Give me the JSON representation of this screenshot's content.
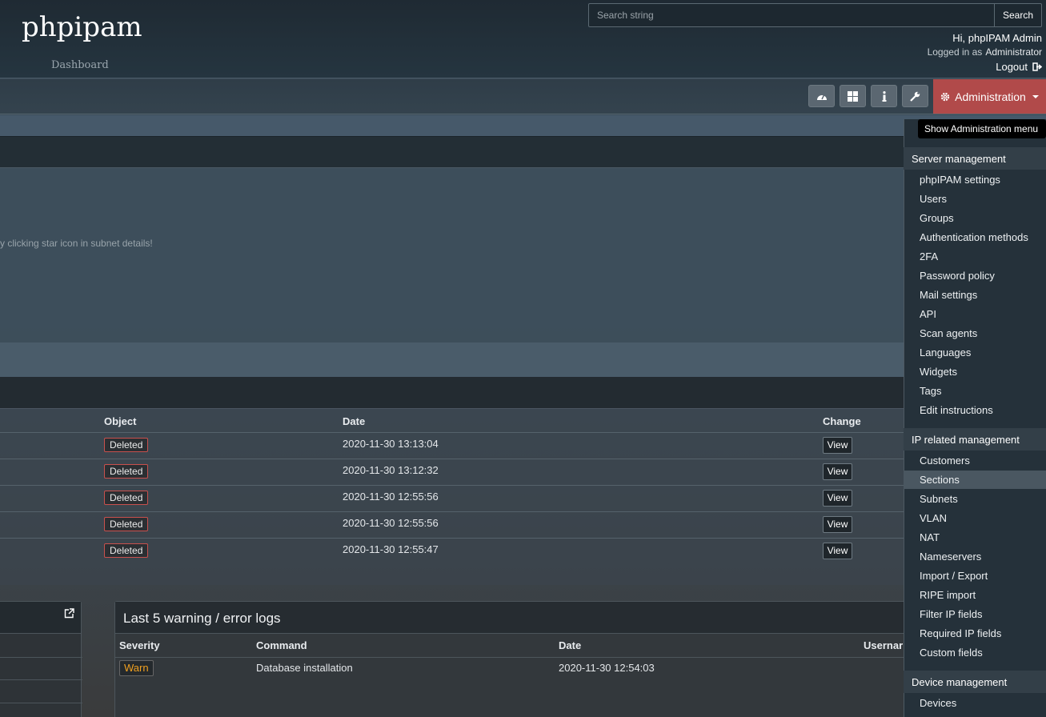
{
  "header": {
    "brand": "phpipam",
    "subtitle": "Dashboard",
    "search": {
      "placeholder": "Search string",
      "button": "Search"
    },
    "user": {
      "greeting": "Hi, phpIPAM Admin",
      "logged_as_label": "Logged in as",
      "role": "Administrator",
      "logout": "Logout"
    }
  },
  "toolbar": {
    "buttons": [
      "dashboard-icon",
      "widgets-icon",
      "info-icon",
      "wrench-icon"
    ],
    "admin_label": "Administration",
    "tooltip": "Show Administration menu",
    "accent": "#b14a4a"
  },
  "favourites": {
    "note": "y clicking star icon in subnet details!"
  },
  "changelog": {
    "columns": {
      "object": "Object",
      "date": "Date",
      "change": "Change"
    },
    "rows": [
      {
        "object": "Deleted",
        "date": "2020-11-30 13:13:04",
        "change": "View"
      },
      {
        "object": "Deleted",
        "date": "2020-11-30 13:12:32",
        "change": "View"
      },
      {
        "object": "Deleted",
        "date": "2020-11-30 12:55:56",
        "change": "View"
      },
      {
        "object": "Deleted",
        "date": "2020-11-30 12:55:56",
        "change": "View"
      },
      {
        "object": "Deleted",
        "date": "2020-11-30 12:55:47",
        "change": "View"
      }
    ]
  },
  "logs": {
    "title": "Last 5 warning / error logs",
    "columns": {
      "severity": "Severity",
      "command": "Command",
      "date": "Date",
      "username": "Usernar"
    },
    "rows": [
      {
        "severity": "Warn",
        "command": "Database installation",
        "date": "2020-11-30 12:54:03"
      }
    ]
  },
  "admin_menu": {
    "server_header": "Server management",
    "server_items": [
      "phpIPAM settings",
      "Users",
      "Groups",
      "Authentication methods",
      "2FA",
      "Password policy",
      "Mail settings",
      "API",
      "Scan agents",
      "Languages",
      "Widgets",
      "Tags",
      "Edit instructions"
    ],
    "ip_header": "IP related management",
    "ip_items": [
      "Customers",
      "Sections",
      "Subnets",
      "VLAN",
      "NAT",
      "Nameservers",
      "Import / Export",
      "RIPE import",
      "Filter IP fields",
      "Required IP fields",
      "Custom fields"
    ],
    "active_item": "Sections",
    "device_header": "Device management",
    "device_items": [
      "Devices"
    ]
  }
}
